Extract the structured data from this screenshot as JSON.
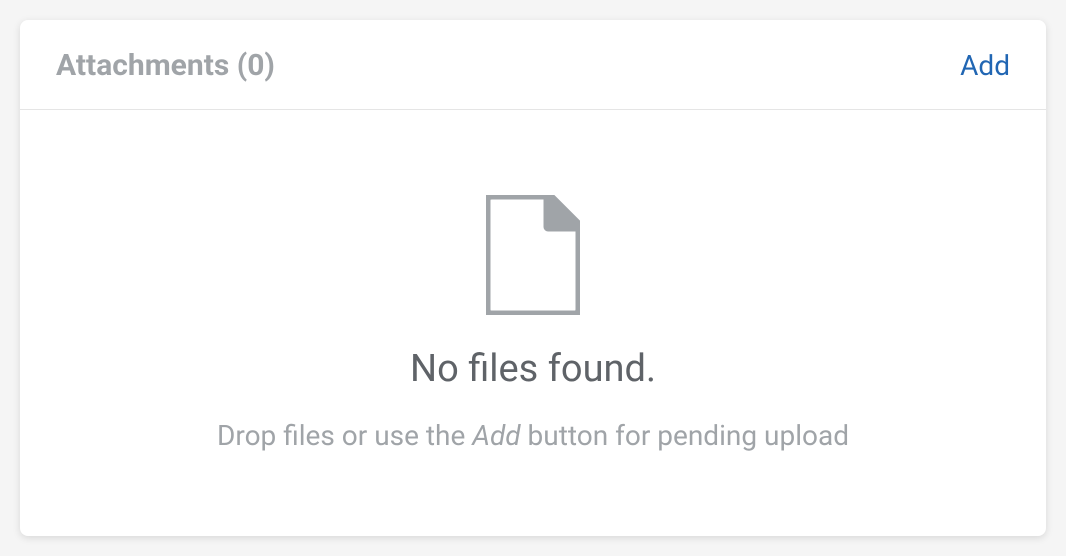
{
  "header": {
    "title": "Attachments (0)",
    "add_label": "Add"
  },
  "empty_state": {
    "title": "No files found.",
    "hint_before": "Drop files or use the ",
    "hint_em": "Add",
    "hint_after": " button for pending upload"
  }
}
